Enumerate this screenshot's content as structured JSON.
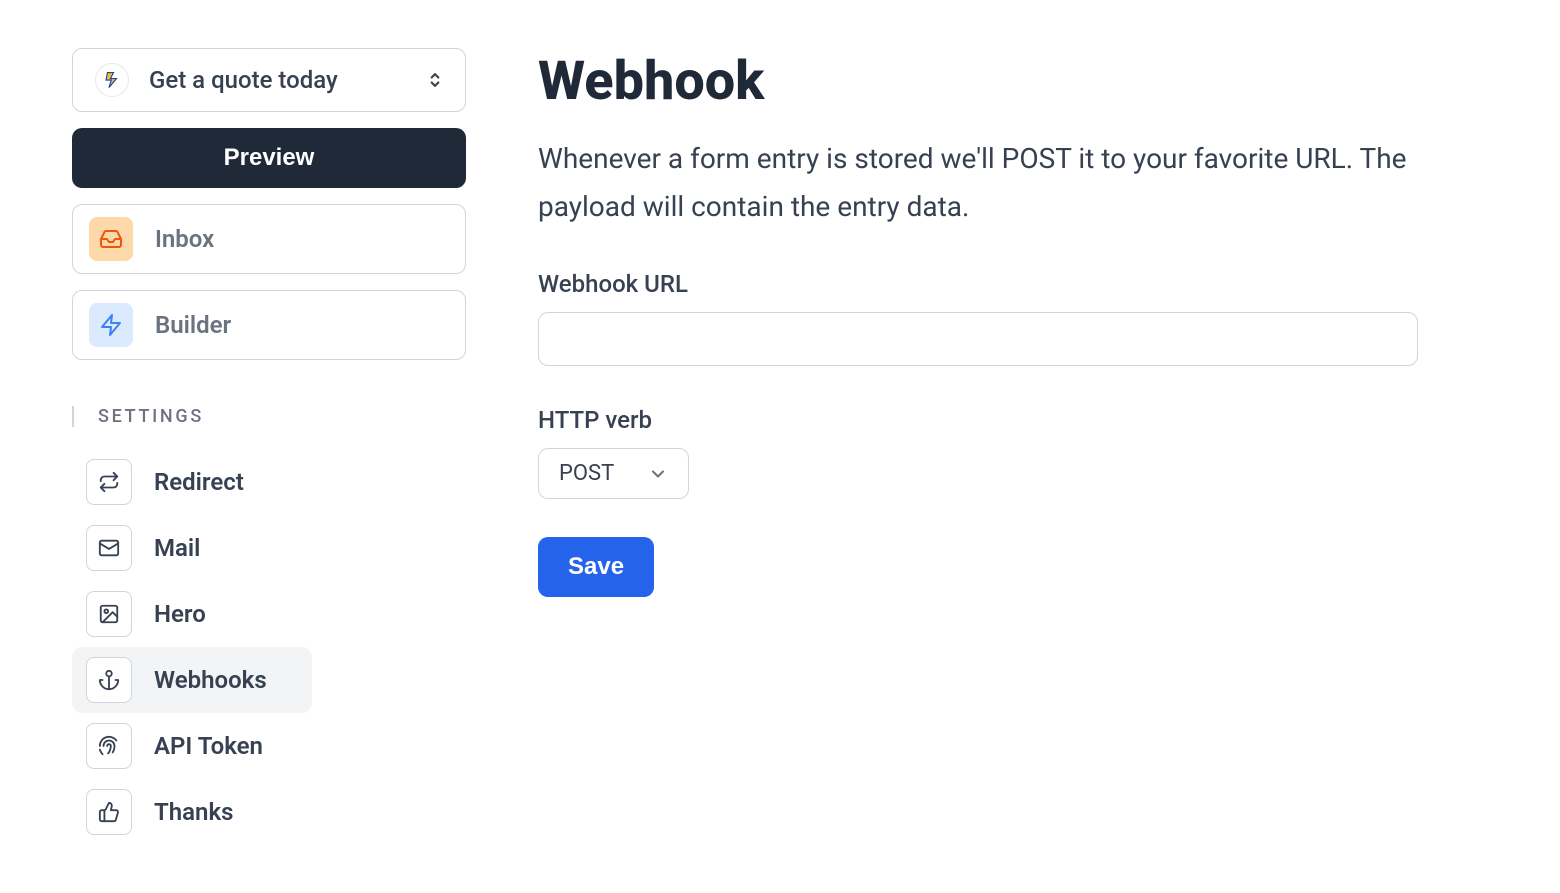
{
  "form_selector": {
    "label": "Get a quote today"
  },
  "preview_button": "Preview",
  "nav": {
    "inbox": "Inbox",
    "builder": "Builder"
  },
  "settings": {
    "header": "SETTINGS",
    "items": [
      {
        "label": "Redirect"
      },
      {
        "label": "Mail"
      },
      {
        "label": "Hero"
      },
      {
        "label": "Webhooks"
      },
      {
        "label": "API Token"
      },
      {
        "label": "Thanks"
      }
    ]
  },
  "page": {
    "title": "Webhook",
    "description": "Whenever a form entry is stored we'll POST it to your favorite URL. The payload will contain the entry data."
  },
  "fields": {
    "url_label": "Webhook URL",
    "url_value": "",
    "verb_label": "HTTP verb",
    "verb_value": "POST"
  },
  "save_button": "Save"
}
